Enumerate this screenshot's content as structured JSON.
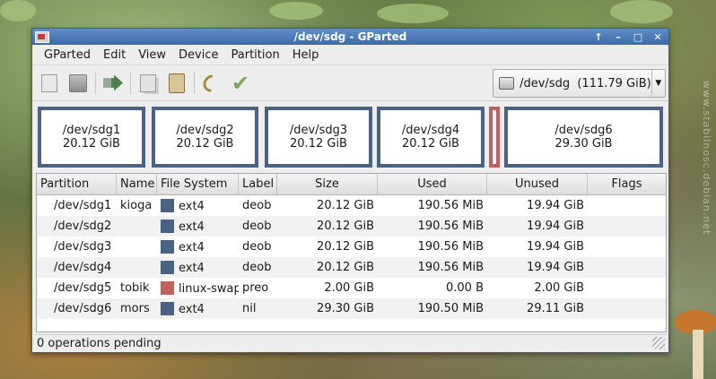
{
  "window": {
    "title": "/dev/sdg - GParted"
  },
  "wm_buttons": {
    "up": "↑",
    "minimize": "–",
    "maximize": "□",
    "close": "✕"
  },
  "menu": [
    "GParted",
    "Edit",
    "View",
    "Device",
    "Partition",
    "Help"
  ],
  "toolbar": {
    "icons": [
      "new-icon",
      "delete-icon",
      "resize-move-icon",
      "copy-icon",
      "paste-icon",
      "undo-icon",
      "apply-icon"
    ]
  },
  "device": {
    "label": "/dev/sdg  (111.79 GiB)",
    "arrow": "▼"
  },
  "diskmap": [
    {
      "name": "/dev/sdg1",
      "size": "20.12 GiB"
    },
    {
      "name": "/dev/sdg2",
      "size": "20.12 GiB"
    },
    {
      "name": "/dev/sdg3",
      "size": "20.12 GiB"
    },
    {
      "name": "/dev/sdg4",
      "size": "20.12 GiB"
    },
    {
      "name": "",
      "size": ""
    },
    {
      "name": "/dev/sdg6",
      "size": "29.30 GiB"
    }
  ],
  "table": {
    "columns": [
      "Partition",
      "Name",
      "File System",
      "Label",
      "Size",
      "Used",
      "Unused",
      "Flags"
    ],
    "rows": [
      {
        "partition": "/dev/sdg1",
        "name": "kioga",
        "fs": "ext4",
        "label": "deob",
        "size": "20.12 GiB",
        "used": "190.56 MiB",
        "unused": "19.94 GiB",
        "flags": ""
      },
      {
        "partition": "/dev/sdg2",
        "name": "",
        "fs": "ext4",
        "label": "deob",
        "size": "20.12 GiB",
        "used": "190.56 MiB",
        "unused": "19.94 GiB",
        "flags": ""
      },
      {
        "partition": "/dev/sdg3",
        "name": "",
        "fs": "ext4",
        "label": "deob",
        "size": "20.12 GiB",
        "used": "190.56 MiB",
        "unused": "19.94 GiB",
        "flags": ""
      },
      {
        "partition": "/dev/sdg4",
        "name": "",
        "fs": "ext4",
        "label": "deob",
        "size": "20.12 GiB",
        "used": "190.56 MiB",
        "unused": "19.94 GiB",
        "flags": ""
      },
      {
        "partition": "/dev/sdg5",
        "name": "tobik",
        "fs": "linux-swap",
        "label": "preo",
        "size": "2.00 GiB",
        "used": "0.00 B",
        "unused": "2.00 GiB",
        "flags": ""
      },
      {
        "partition": "/dev/sdg6",
        "name": "mors",
        "fs": "ext4",
        "label": "nil",
        "size": "29.30 GiB",
        "used": "190.50 MiB",
        "unused": "29.11 GiB",
        "flags": ""
      }
    ]
  },
  "colors": {
    "ext4": "#4a6385",
    "linux-swap": "#c0625c"
  },
  "status": {
    "text": "0 operations pending"
  },
  "watermark": "www.stabilnosc.debian.net"
}
